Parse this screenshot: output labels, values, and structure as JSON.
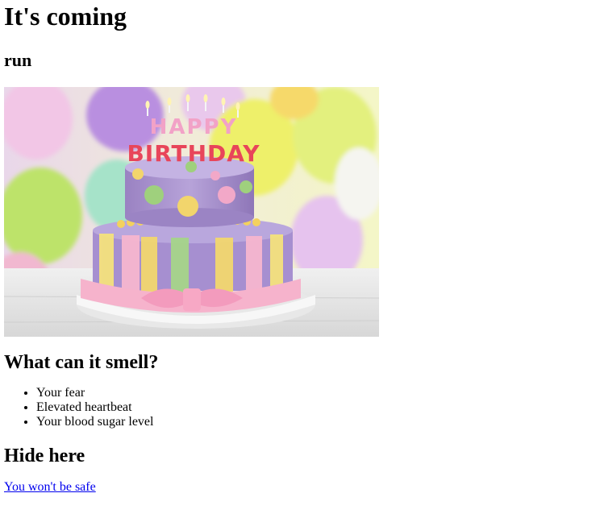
{
  "page": {
    "title": "It's coming",
    "subtitle": "run"
  },
  "image": {
    "topper_line1": "HAPPY",
    "topper_line2": "BIRTHDAY"
  },
  "smell_section": {
    "heading": "What can it smell?",
    "items": [
      "Your fear",
      "Elevated heartbeat",
      "Your blood sugar level"
    ]
  },
  "hide_section": {
    "heading": "Hide here",
    "link_text": "You won't be safe"
  }
}
